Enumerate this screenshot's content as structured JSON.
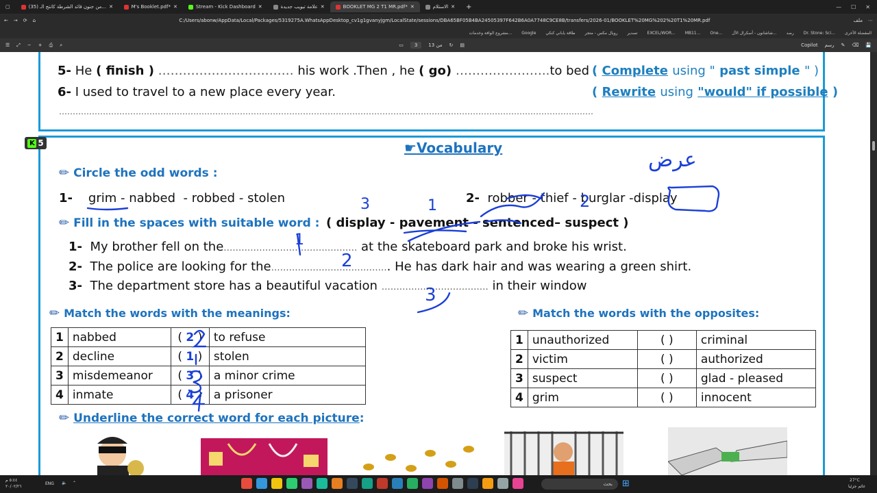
{
  "browser": {
    "tabs": [
      {
        "label": "(35) من جنون قائد الشرطة كانتج الـ...",
        "active": false,
        "icon": "youtube"
      },
      {
        "label": "M's Booklet.pdf*",
        "active": false,
        "icon": "pdf"
      },
      {
        "label": "Stream - Kick Dashboard",
        "active": false,
        "icon": "kick"
      },
      {
        "label": "علامة تبويب جديدة",
        "active": false,
        "icon": "blank"
      },
      {
        "label": "BOOKLET MG 2 T1 MR.pdf*",
        "active": true,
        "icon": "pdf"
      },
      {
        "label": "الاستلام",
        "active": false,
        "icon": "blank"
      }
    ],
    "url": "C:/Users/abonw/AppData/Local/Packages/5319275A.WhatsAppDesktop_cv1g1gvanyjgm/LocalState/sessions/DBA65BF05B4BA24505397F642B6A0A7748C9CE8B/transfers/2026-01/BOOKLET%20MG%202%20T1%20MR.pdf",
    "url_prefix": "ملف",
    "bookmarks": [
      "المفضلة الأخرى",
      "Dr. Stone: Sci...",
      "رصد",
      "شاشانون - أسكرال الأل...",
      "One...",
      "MB11...",
      "EXCEL/WOR...",
      "تصدير",
      "رويال مكس - متجر",
      "طاقة ياباني كنكي",
      "Google",
      "مشروع الوافة وخدمات..."
    ],
    "pdf_page_current": "3",
    "pdf_page_total": "من 13",
    "pdf_copilot": "Copilot",
    "pdf_draw": "رسم"
  },
  "ex_top": {
    "q5": {
      "num": "5-",
      "before": "He",
      "word1": "( finish )",
      "dots1": "……………………………",
      "mid": "his work .Then , he",
      "word2": "( go)",
      "dots2": "…………………..",
      "end": "to bed .",
      "instr_open": "(",
      "instr_key": "Complete",
      "instr_rest": "using \"",
      "instr_word": "past simple",
      "instr_close": "\" )"
    },
    "q6": {
      "num": "6-",
      "text": "I used to travel to a new place every year.",
      "instr_open": "(",
      "instr_key": "Rewrite",
      "instr_rest": "using",
      "instr_word": "\"would\" if possible",
      "instr_close": ")"
    },
    "dots_line": "……………………………………………………………………………………………………………………………………………………………………………"
  },
  "badge": {
    "k": "K",
    "num": "5"
  },
  "vocab": {
    "heading": "Vocabulary",
    "circle": {
      "title": "Circle the odd words",
      "colon": ":",
      "q1": {
        "num": "1-",
        "words": [
          "grim",
          "nabbed",
          "robbed",
          "stolen"
        ],
        "sep": "-"
      },
      "q2": {
        "num": "2-",
        "words": [
          "robber",
          "thief",
          "burglar",
          "display"
        ],
        "sep": "-"
      }
    },
    "fill": {
      "title": "Fill  in the spaces with suitable word :",
      "options": "( display  -  pavement  -  sentenced–  suspect  )",
      "items": [
        {
          "num": "1-",
          "before": "My brother fell on the",
          "dots": "………………………………………",
          "after": "at the skateboard park and broke his wrist."
        },
        {
          "num": "2-",
          "before": "The police are looking for the",
          "dots": "…………………………………",
          "after": ". He has dark hair and was wearing a green shirt."
        },
        {
          "num": "3-",
          "before": "The department store has a beautiful vacation",
          "dots": "………………………………",
          "after": "in their window"
        }
      ]
    },
    "meanings": {
      "title": "Match the words with the meanings",
      "colon": ":",
      "rows": [
        {
          "n": "1",
          "word": "nabbed",
          "bracket": "(   )",
          "meaning": "to refuse"
        },
        {
          "n": "2",
          "word": "decline",
          "bracket": "(   )",
          "meaning": "stolen"
        },
        {
          "n": "3",
          "word": "misdemeanor",
          "bracket": "(   )",
          "meaning": "a minor crime"
        },
        {
          "n": "4",
          "word": "inmate",
          "bracket": "(   )",
          "meaning": "a prisoner"
        }
      ]
    },
    "opposites": {
      "title": "Match the words with the opposites",
      "colon": ":",
      "rows": [
        {
          "n": "1",
          "word": "unauthorized",
          "bracket": "(     )",
          "meaning": "criminal"
        },
        {
          "n": "2",
          "word": "victim",
          "bracket": "(     )",
          "meaning": "authorized"
        },
        {
          "n": "3",
          "word": "suspect",
          "bracket": "(     )",
          "meaning": "glad - pleased"
        },
        {
          "n": "4",
          "word": "grim",
          "bracket": "(     )",
          "meaning": "innocent"
        }
      ]
    },
    "underline": {
      "title": "Underline the correct word for each  picture",
      "colon": ":"
    }
  },
  "handwriting": {
    "arabic_note": "عرض",
    "fill_answers": [
      "1",
      "2",
      "3"
    ],
    "circle_marks": [
      "3",
      "1",
      "2"
    ],
    "meanings_answers": [
      "2",
      "1",
      "3",
      "4"
    ]
  },
  "taskbar": {
    "search": "بحث",
    "lang": "ENG",
    "weather_temp": "27°C",
    "weather_desc": "غائم جزئيا",
    "time": "٥:٤٤ م",
    "date": "٢٠/٠٢/٢٦"
  },
  "colors": {
    "frame_blue": "#1a9ad6",
    "heading_blue": "#1e73be",
    "ink_blue": "#1a3fd6",
    "kick_green": "#53fc18"
  }
}
